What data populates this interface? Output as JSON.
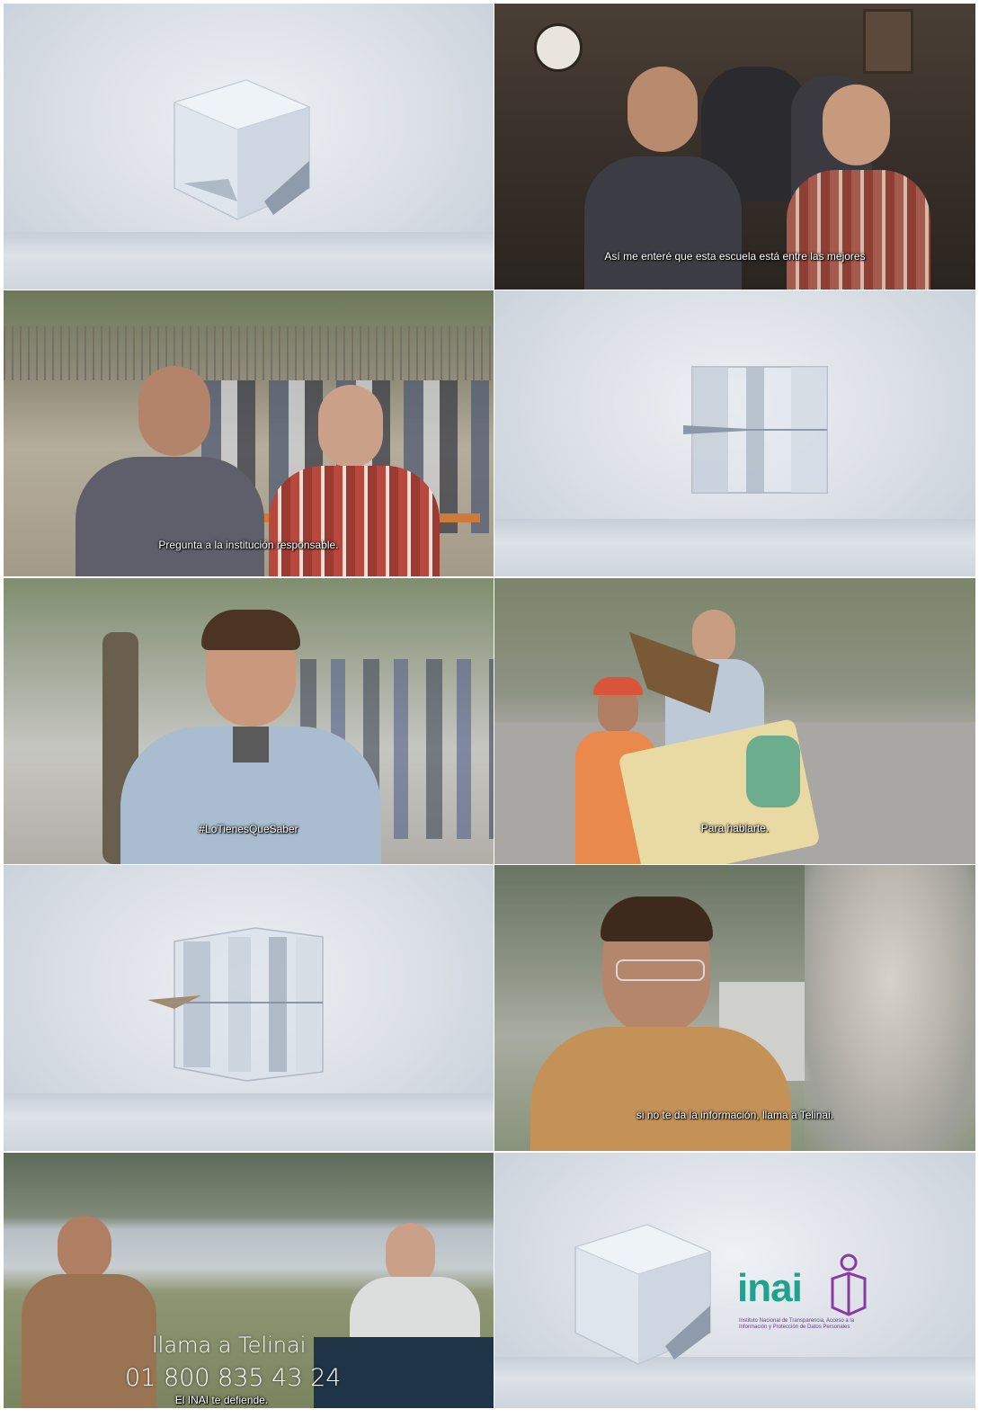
{
  "frames": [
    {
      "id": 1,
      "kind": "studio-cube"
    },
    {
      "id": 2,
      "kind": "scene",
      "subtitle": "Así me enteré que esta escuela está entre las mejores"
    },
    {
      "id": 3,
      "kind": "scene",
      "subtitle": "Pregunta a la institución responsable."
    },
    {
      "id": 4,
      "kind": "studio-cube"
    },
    {
      "id": 5,
      "kind": "scene",
      "subtitle": "#LoTienesQueSaber"
    },
    {
      "id": 6,
      "kind": "scene",
      "subtitle": "Para hablarte."
    },
    {
      "id": 7,
      "kind": "studio-cube"
    },
    {
      "id": 8,
      "kind": "scene",
      "subtitle": "si no te da la información, llama a Telinai."
    },
    {
      "id": 9,
      "kind": "scene",
      "line1": "llama a Telinai",
      "line2": "01 800 835 43 24",
      "subtitle": "El INAI te defiende."
    },
    {
      "id": 10,
      "kind": "logo"
    }
  ],
  "logo": {
    "word": "inai",
    "tagline_1": "Instituto Nacional de Transparencia, Acceso a la",
    "tagline_2": "Información y Protección de Datos Personales",
    "color_word": "#1fa38f",
    "color_mark": "#8a3aa3"
  }
}
